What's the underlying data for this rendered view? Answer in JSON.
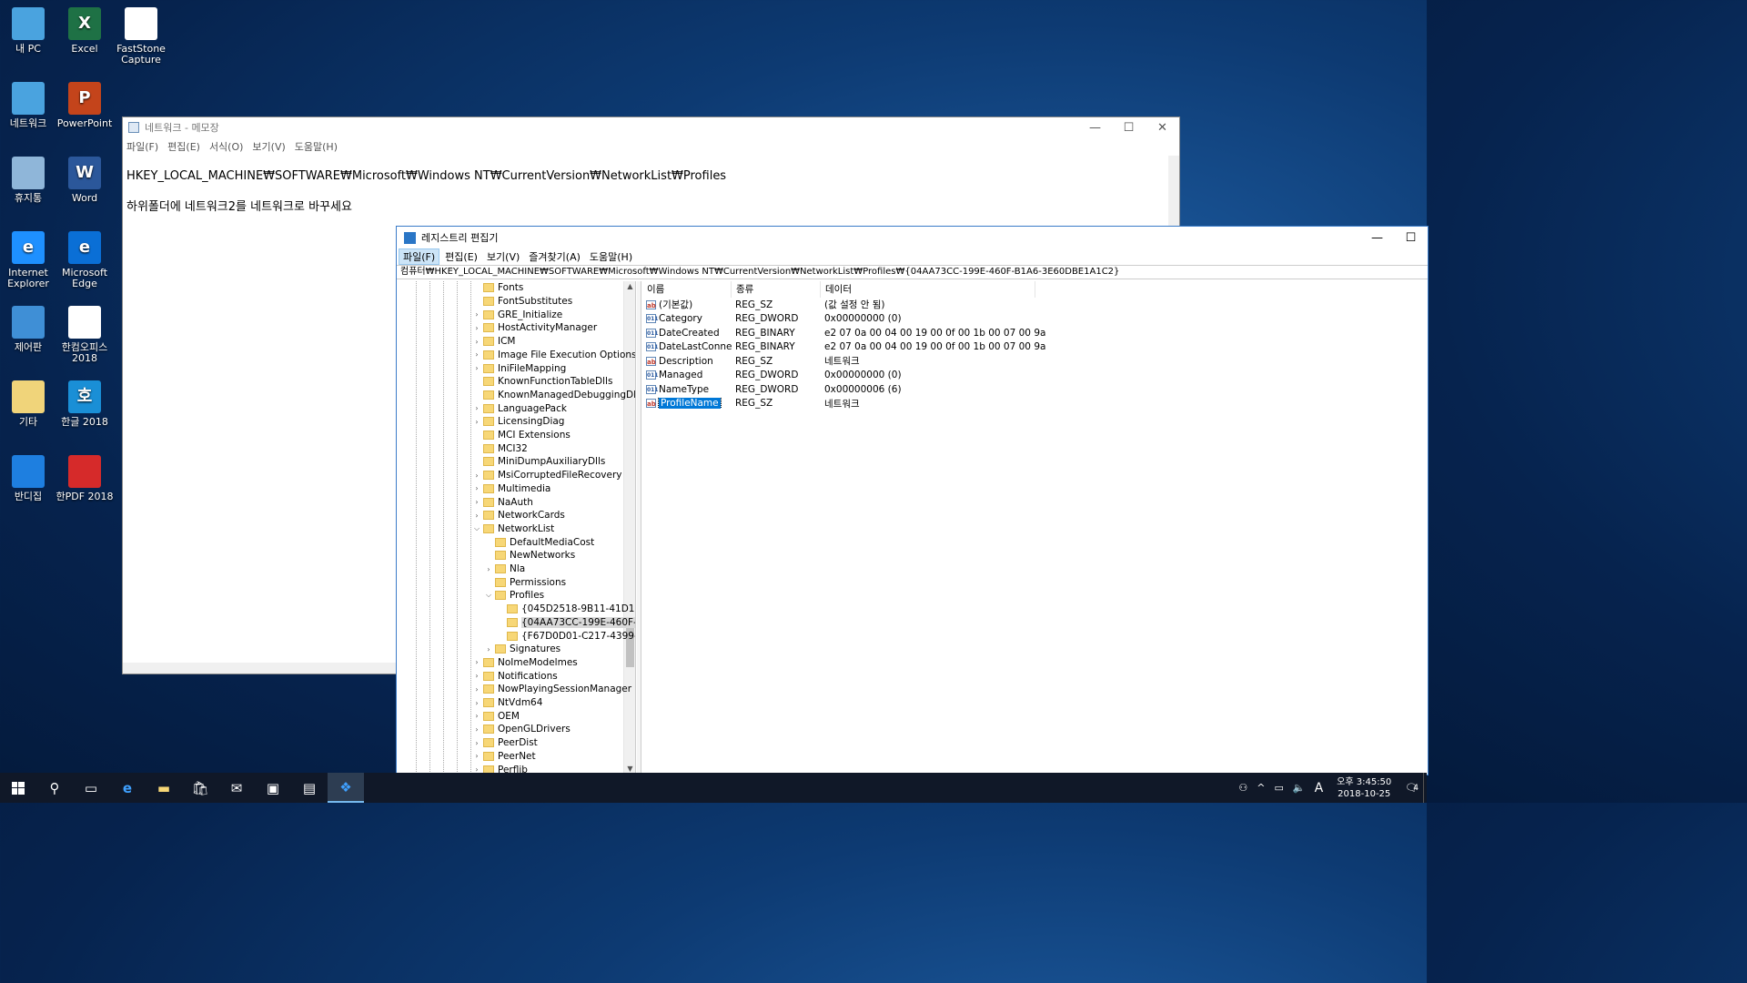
{
  "desktop": {
    "icons": [
      {
        "label": "내 PC",
        "icon": "computer-icon"
      },
      {
        "label": "Excel",
        "icon": "excel-icon",
        "glyph": "X"
      },
      {
        "label": "FastStone Capture",
        "icon": "faststone-icon"
      },
      {
        "label": "네트워크",
        "icon": "network-icon"
      },
      {
        "label": "PowerPoint",
        "icon": "powerpoint-icon",
        "glyph": "P"
      },
      {
        "label": "휴지통",
        "icon": "recycle-bin-icon"
      },
      {
        "label": "Word",
        "icon": "word-icon",
        "glyph": "W"
      },
      {
        "label": "Internet Explorer",
        "icon": "ie-icon",
        "glyph": "e"
      },
      {
        "label": "Microsoft Edge",
        "icon": "edge-icon",
        "glyph": "e"
      },
      {
        "label": "제어판",
        "icon": "control-panel-icon"
      },
      {
        "label": "한컴오피스 2018",
        "icon": "hancom-office-icon"
      },
      {
        "label": "기타",
        "icon": "folder-icon"
      },
      {
        "label": "한글 2018",
        "icon": "hangul-icon",
        "glyph": "호"
      },
      {
        "label": "반디집",
        "icon": "bandizip-icon"
      },
      {
        "label": "한PDF 2018",
        "icon": "hanpdf-icon"
      }
    ]
  },
  "notepad": {
    "title": "네트워크 - 메모장",
    "menu": [
      "파일(F)",
      "편집(E)",
      "서식(O)",
      "보기(V)",
      "도움말(H)"
    ],
    "lines": [
      "HKEY_LOCAL_MACHINE₩SOFTWARE₩Microsoft₩Windows NT₩CurrentVersion₩NetworkList₩Profiles",
      "하위폴더에 네트워크2를 네트워크로 바꾸세요"
    ]
  },
  "regedit": {
    "title": "레지스트리 편집기",
    "menu": [
      "파일(F)",
      "편집(E)",
      "보기(V)",
      "즐겨찾기(A)",
      "도움말(H)"
    ],
    "address": "컴퓨터₩HKEY_LOCAL_MACHINE₩SOFTWARE₩Microsoft₩Windows NT₩CurrentVersion₩NetworkList₩Profiles₩{04AA73CC-199E-460F-B1A6-3E60DBE1A1C2}",
    "tree": [
      {
        "label": "Fonts",
        "level": 0,
        "exp": ""
      },
      {
        "label": "FontSubstitutes",
        "level": 0,
        "exp": ""
      },
      {
        "label": "GRE_Initialize",
        "level": 0,
        "exp": ">"
      },
      {
        "label": "HostActivityManager",
        "level": 0,
        "exp": ">"
      },
      {
        "label": "ICM",
        "level": 0,
        "exp": ">"
      },
      {
        "label": "Image File Execution Options",
        "level": 0,
        "exp": ">"
      },
      {
        "label": "IniFileMapping",
        "level": 0,
        "exp": ">"
      },
      {
        "label": "KnownFunctionTableDlls",
        "level": 0,
        "exp": ""
      },
      {
        "label": "KnownManagedDebuggingDlls",
        "level": 0,
        "exp": ""
      },
      {
        "label": "LanguagePack",
        "level": 0,
        "exp": ">"
      },
      {
        "label": "LicensingDiag",
        "level": 0,
        "exp": ">"
      },
      {
        "label": "MCI Extensions",
        "level": 0,
        "exp": ""
      },
      {
        "label": "MCI32",
        "level": 0,
        "exp": ""
      },
      {
        "label": "MiniDumpAuxiliaryDlls",
        "level": 0,
        "exp": ""
      },
      {
        "label": "MsiCorruptedFileRecovery",
        "level": 0,
        "exp": ">"
      },
      {
        "label": "Multimedia",
        "level": 0,
        "exp": ">"
      },
      {
        "label": "NaAuth",
        "level": 0,
        "exp": ">"
      },
      {
        "label": "NetworkCards",
        "level": 0,
        "exp": ">"
      },
      {
        "label": "NetworkList",
        "level": 0,
        "exp": "v"
      },
      {
        "label": "DefaultMediaCost",
        "level": 1,
        "exp": ""
      },
      {
        "label": "NewNetworks",
        "level": 1,
        "exp": ""
      },
      {
        "label": "Nla",
        "level": 1,
        "exp": ">"
      },
      {
        "label": "Permissions",
        "level": 1,
        "exp": ""
      },
      {
        "label": "Profiles",
        "level": 1,
        "exp": "v"
      },
      {
        "label": "{045D2518-9B11-41D1-",
        "level": 2,
        "exp": ""
      },
      {
        "label": "{04AA73CC-199E-460F-B",
        "level": 2,
        "exp": "",
        "selected": true
      },
      {
        "label": "{F67D0D01-C217-4399-",
        "level": 2,
        "exp": ""
      },
      {
        "label": "Signatures",
        "level": 1,
        "exp": ">"
      },
      {
        "label": "NoImeModelmes",
        "level": 0,
        "exp": ">"
      },
      {
        "label": "Notifications",
        "level": 0,
        "exp": ">"
      },
      {
        "label": "NowPlayingSessionManager",
        "level": 0,
        "exp": ">"
      },
      {
        "label": "NtVdm64",
        "level": 0,
        "exp": ">"
      },
      {
        "label": "OEM",
        "level": 0,
        "exp": ">"
      },
      {
        "label": "OpenGLDrivers",
        "level": 0,
        "exp": ">"
      },
      {
        "label": "PeerDist",
        "level": 0,
        "exp": ">"
      },
      {
        "label": "PeerNet",
        "level": 0,
        "exp": ">"
      },
      {
        "label": "Perflib",
        "level": 0,
        "exp": ">"
      }
    ],
    "columns": [
      "이름",
      "종류",
      "데이터"
    ],
    "values": [
      {
        "name": "(기본값)",
        "type": "REG_SZ",
        "data": "(값 설정 안 됨)",
        "icon": "ab"
      },
      {
        "name": "Category",
        "type": "REG_DWORD",
        "data": "0x00000000 (0)",
        "icon": "bin"
      },
      {
        "name": "DateCreated",
        "type": "REG_BINARY",
        "data": "e2 07 0a 00 04 00 19 00 0f 00 1b 00 07 00 9a",
        "icon": "bin"
      },
      {
        "name": "DateLastConnec",
        "type": "REG_BINARY",
        "data": "e2 07 0a 00 04 00 19 00 0f 00 1b 00 07 00 9a",
        "icon": "bin"
      },
      {
        "name": "Description",
        "type": "REG_SZ",
        "data": "네트워크",
        "icon": "ab"
      },
      {
        "name": "Managed",
        "type": "REG_DWORD",
        "data": "0x00000000 (0)",
        "icon": "bin"
      },
      {
        "name": "NameType",
        "type": "REG_DWORD",
        "data": "0x00000006 (6)",
        "icon": "bin"
      },
      {
        "name": "ProfileName",
        "type": "REG_SZ",
        "data": "네트워크",
        "icon": "ab",
        "selected": true
      }
    ]
  },
  "taskbar": {
    "clock_time": "오후 3:45:50",
    "clock_date": "2018-10-25",
    "ime": "A",
    "notification_count": "4"
  }
}
